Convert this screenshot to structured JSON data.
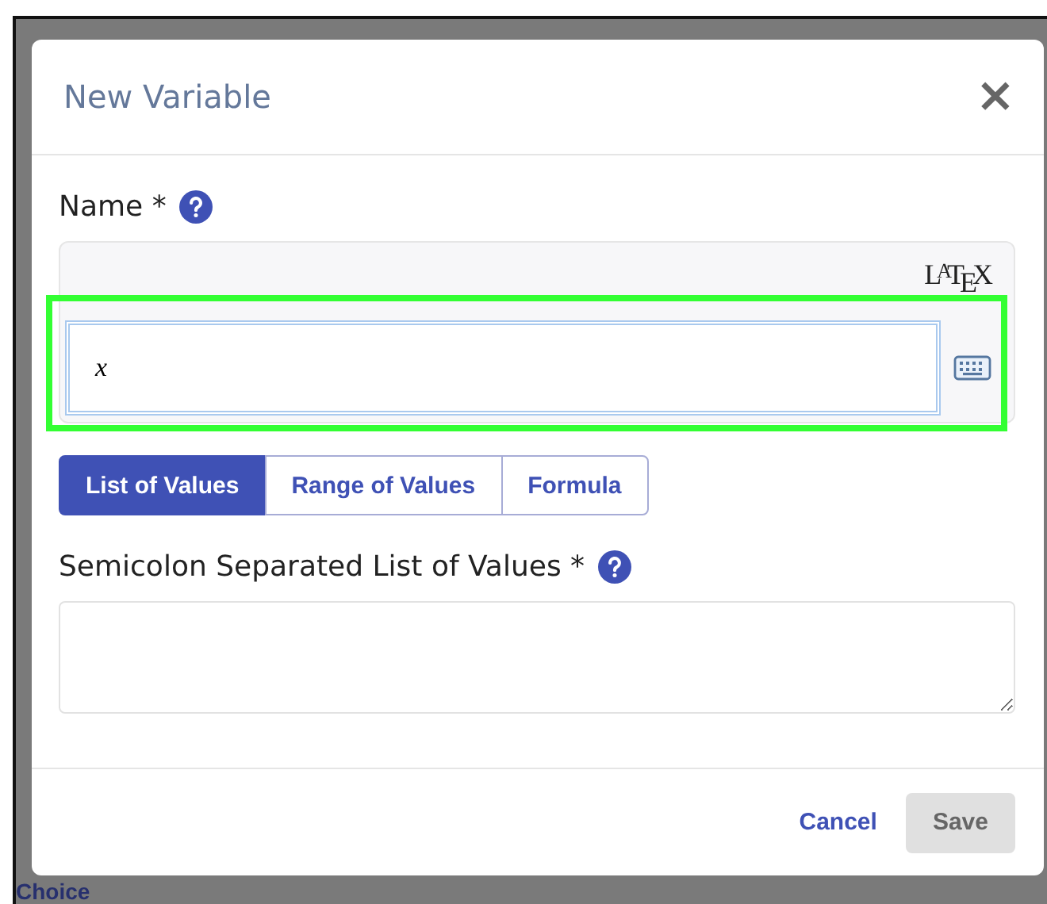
{
  "background": {
    "text": "Choice"
  },
  "dialog": {
    "title": "New Variable",
    "close": "×"
  },
  "name_field": {
    "label": "Name *",
    "editor_label": "L$^{A}$T$_{E}$X",
    "value": "x",
    "highlighted": true
  },
  "tabs": [
    {
      "label": "List of Values",
      "selected": true
    },
    {
      "label": "Range of Values",
      "selected": false
    },
    {
      "label": "Formula",
      "selected": false
    }
  ],
  "values_field": {
    "label": "Semicolon Separated List of Values *"
  },
  "buttons": [
    {
      "label": "Cancel",
      "kind": "link",
      "disabled": false
    },
    {
      "label": "Save",
      "kind": "filled",
      "disabled": true
    }
  ]
}
